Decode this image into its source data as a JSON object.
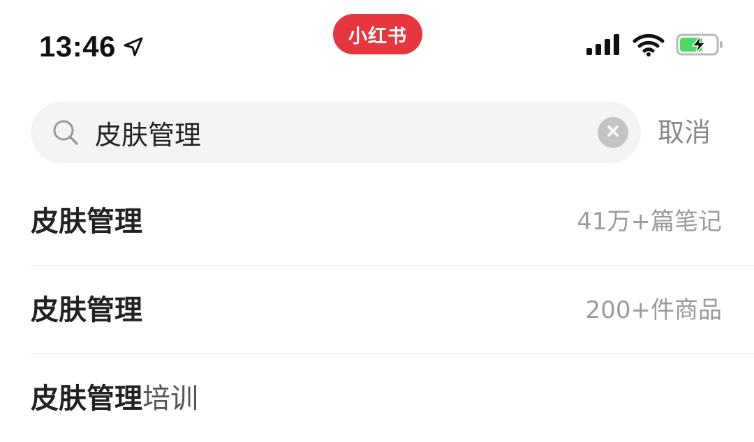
{
  "status_bar": {
    "time": "13:46",
    "app_badge": "小红书",
    "icons": [
      "location-arrow-icon",
      "cellular-signal-icon",
      "wifi-icon",
      "battery-charging-icon"
    ],
    "colors": {
      "badge": "#e8363f",
      "battery_fill": "#4cd964"
    }
  },
  "search": {
    "query": "皮肤管理",
    "placeholder": "",
    "cancel_label": "取消",
    "icon": "search-icon",
    "clear_icon": "clear-icon"
  },
  "suggestions": [
    {
      "keyword": "皮肤管理",
      "suffix": "",
      "meta": "41万+篇笔记"
    },
    {
      "keyword": "皮肤管理",
      "suffix": "",
      "meta": "200+件商品"
    },
    {
      "keyword": "皮肤管理",
      "suffix": "培训",
      "meta": ""
    }
  ]
}
